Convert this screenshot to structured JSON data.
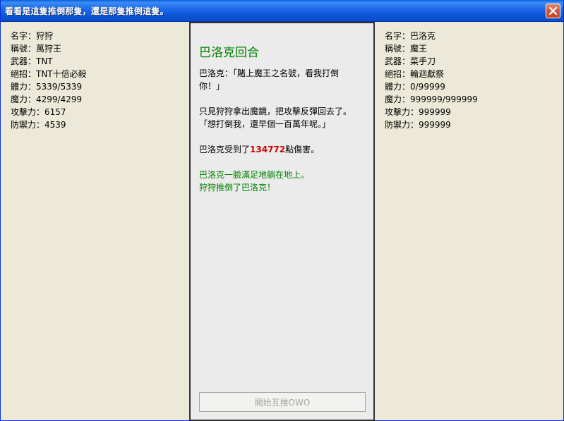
{
  "window": {
    "title": "看看是這隻推倒那隻，還是那隻推倒這隻。",
    "close_icon": "close-icon",
    "colors": {
      "titlebar": "#0b54d6",
      "close_button": "#d35a3c"
    }
  },
  "left_stats": [
    "名字：狩狩",
    "稱號：萬狩王",
    "武器：TNT",
    "絕招：TNT十倍必殺",
    "體力：5339/5339",
    "魔力：4299/4299",
    "攻擊力：6157",
    "防禦力：4539"
  ],
  "right_stats": [
    "名字：巴洛克",
    "稱號：魔王",
    "武器：菜手刀",
    "絕招：輪迴獻祭",
    "體力：0/99999",
    "魔力：999999/999999",
    "攻擊力：999999",
    "防禦力：999999"
  ],
  "battle": {
    "round_title": "巴洛克回合",
    "quote_line1": "巴洛克：「賭上魔王之名號，看我打倒",
    "quote_line2": "你！」",
    "reflect_line1": "只見狩狩拿出魔鏡，把攻擊反彈回去了。",
    "reflect_line2": "「想打倒我，還早個一百萬年呢。」",
    "damage_prefix": "巴洛克受到了",
    "damage_value": "134772",
    "damage_suffix": "點傷害。",
    "result_line1": "巴洛克一臉滿足地躺在地上。",
    "result_line2": "狩狩推倒了巴洛克！",
    "colors": {
      "title": "#008000",
      "damage": "#cc0000",
      "result": "#008000"
    }
  },
  "start_button": {
    "label": "開始互推OWO"
  }
}
